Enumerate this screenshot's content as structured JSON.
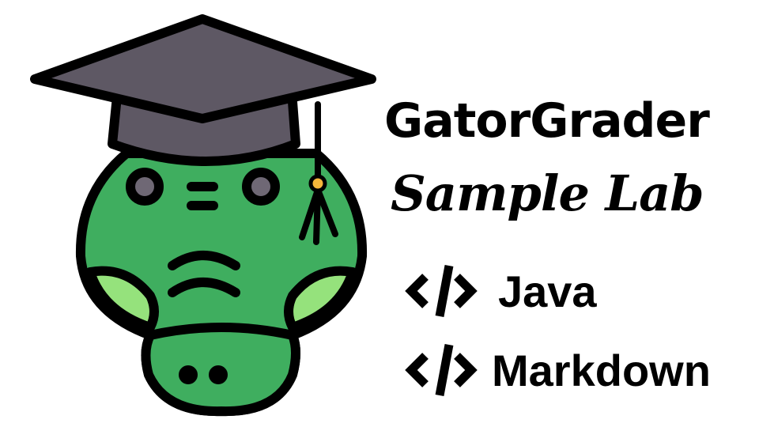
{
  "brand": {
    "title": "GatorGrader",
    "subtitle": "Sample Lab"
  },
  "languages": [
    {
      "label": "Java",
      "icon": "code-icon"
    },
    {
      "label": "Markdown",
      "icon": "code-icon"
    }
  ],
  "colors": {
    "gator_green": "#3fae5f",
    "cheek_green": "#95e27c",
    "cap_gray": "#5e5864",
    "cap_band": "#6e6876",
    "tassel_bead": "#f5b73b",
    "outline": "#000000"
  }
}
